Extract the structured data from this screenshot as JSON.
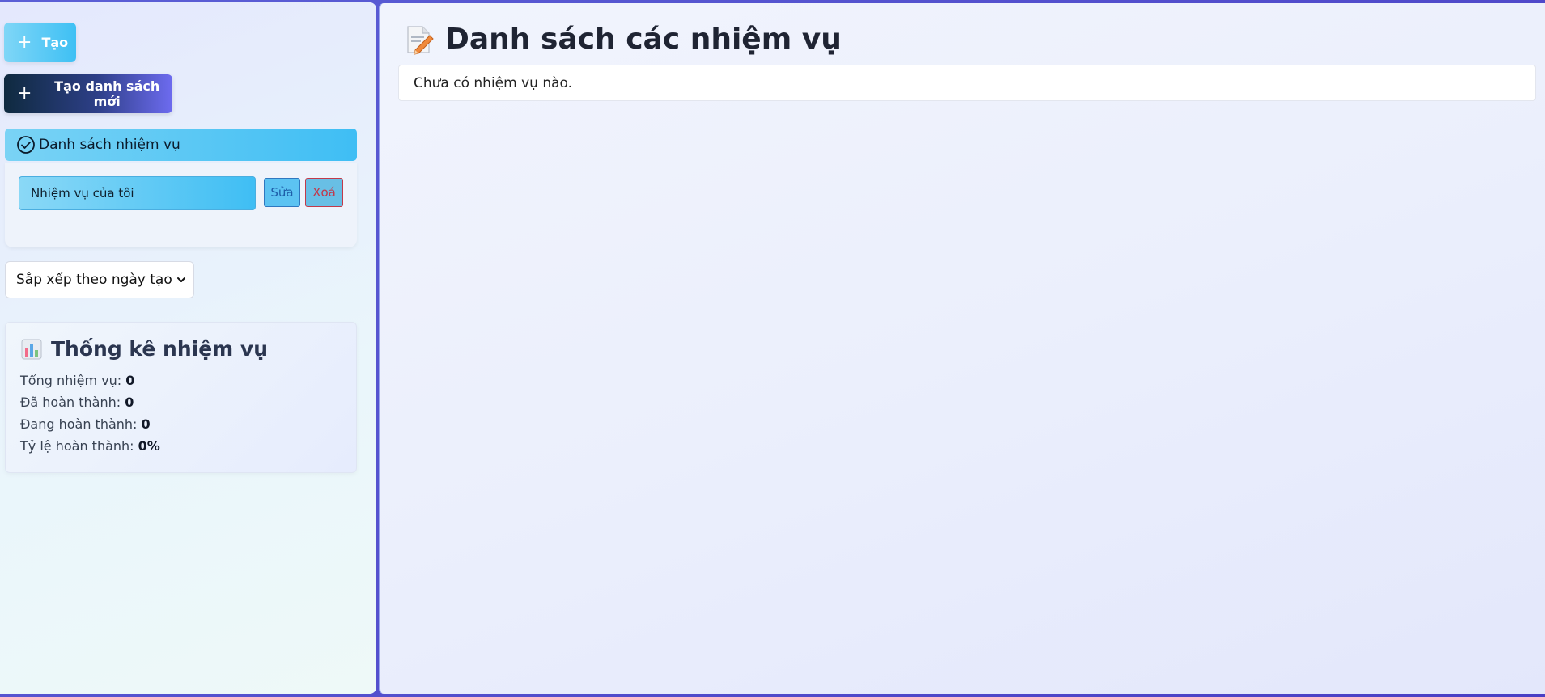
{
  "sidebar": {
    "create_label": "Tạo",
    "new_list_label": "Tạo danh sách mới",
    "list_section_title": "Danh sách nhiệm vụ",
    "lists": [
      {
        "name": "Nhiệm vụ của tôi",
        "edit_label": "Sửa",
        "delete_label": "Xoá"
      }
    ],
    "sort": {
      "selected": "Sắp xếp theo ngày tạo"
    },
    "stats": {
      "title": "Thống kê nhiệm vụ",
      "total_label": "Tổng nhiệm vụ:",
      "total_value": "0",
      "done_label": "Đã hoàn thành:",
      "done_value": "0",
      "pending_label": "Đang hoàn thành:",
      "pending_value": "0",
      "rate_label": "Tỷ lệ hoàn thành:",
      "rate_value": "0%"
    }
  },
  "main": {
    "title": "Danh sách các nhiệm vụ",
    "empty_message": "Chưa có nhiệm vụ nào."
  },
  "icons": {
    "plus": "plus-icon",
    "check": "check-circle-icon",
    "chart": "bar-chart-icon",
    "memo": "memo-icon",
    "chevron": "chevron-down-icon"
  },
  "colors": {
    "accent_cyan": "#3fbef4",
    "dark_navy": "#0f2a3f",
    "purple": "#6d6bef",
    "delete_red": "#c2384a"
  }
}
